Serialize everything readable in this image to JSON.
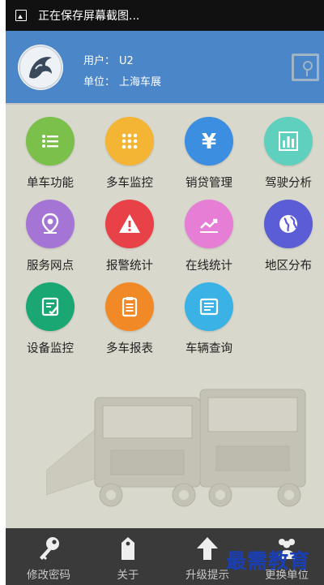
{
  "status_bar": {
    "text": "正在保存屏幕截图..."
  },
  "header": {
    "user_label": "用户：",
    "user_value": "U2",
    "unit_label": "单位：",
    "unit_value": "上海车展",
    "accent_color": "#4a86c8"
  },
  "menu": [
    {
      "label": "单车功能",
      "icon": "list-icon",
      "color": "#7ac04a"
    },
    {
      "label": "多车监控",
      "icon": "dots-grid-icon",
      "color": "#f3b533"
    },
    {
      "label": "销贷管理",
      "icon": "yen-icon",
      "color": "#3b8ee0"
    },
    {
      "label": "驾驶分析",
      "icon": "bar-chart-icon",
      "color": "#5fd0bd"
    },
    {
      "label": "服务网点",
      "icon": "location-pin-icon",
      "color": "#a575d6"
    },
    {
      "label": "报警统计",
      "icon": "alert-icon",
      "color": "#e94148"
    },
    {
      "label": "在线统计",
      "icon": "trend-line-icon",
      "color": "#e67ed6"
    },
    {
      "label": "地区分布",
      "icon": "globe-icon",
      "color": "#5a5dd6"
    },
    {
      "label": "设备监控",
      "icon": "edit-note-icon",
      "color": "#1aa774"
    },
    {
      "label": "多车报表",
      "icon": "clipboard-list-icon",
      "color": "#f18a26"
    },
    {
      "label": "车辆查询",
      "icon": "search-list-icon",
      "color": "#3ab2e6"
    }
  ],
  "bottom_tabs": [
    {
      "label": "修改密码",
      "icon": "key-icon"
    },
    {
      "label": "关于",
      "icon": "tag-icon"
    },
    {
      "label": "升级提示",
      "icon": "arrow-up-icon"
    },
    {
      "label": "更换单位",
      "icon": "users-icon"
    }
  ],
  "watermark": "最需教育"
}
